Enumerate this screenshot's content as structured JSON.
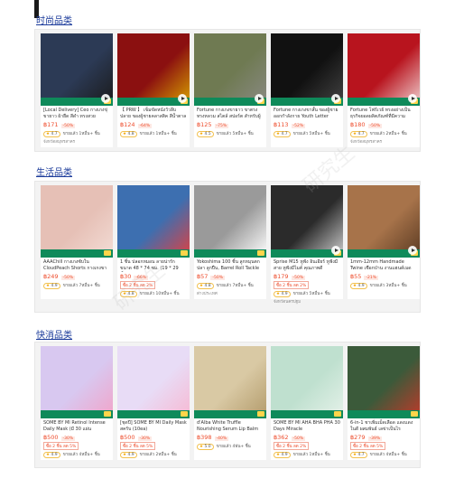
{
  "sections": [
    {
      "title": "时尚品类",
      "products": [
        {
          "title": "[Local Delivery] Ceo กางเกงขุ่ ขายาว ผ้ายืด สีดำ ทรงสวย",
          "price": "฿171",
          "discount": "-50%",
          "promo": "",
          "rating": "4.7",
          "sold": "ขายแล้ว 1หมื่น+ ชิ้น",
          "location": "จังหวัดสมุทรสาคร",
          "has_play": true,
          "colors": [
            "#2c3a55",
            "#1a1a1a"
          ]
        },
        {
          "title": "【 PRW 】 เข็มขัดหนังวัวลีบปลาย ของผู้ชายคลาสสิค สีน้ำตาล",
          "price": "฿124",
          "discount": "-64%",
          "promo": "",
          "rating": "4.8",
          "sold": "ขายแล้ว 1หมื่น+ ชิ้น",
          "location": "",
          "has_play": true,
          "colors": [
            "#8b1010",
            "#d9a400"
          ]
        },
        {
          "title": "Fortune กางเกงขายาว ขาตรง ทรงหลวม สไตล์ สปอร์ต สำหรับผู้",
          "price": "฿125",
          "discount": "-75%",
          "promo": "",
          "rating": "4.5",
          "sold": "ขายแล้ว 5หมื่น+ ชิ้น",
          "location": "",
          "has_play": true,
          "colors": [
            "#6f7a52",
            "#8a8a84"
          ]
        },
        {
          "title": "Fortune กางเกงขาสั้น ของผู้ชายออกกำลังกาย Youth Letter",
          "price": "฿113",
          "discount": "-52%",
          "promo": "",
          "rating": "4.7",
          "sold": "ขายแล้ว 5หมื่น+ ชิ้น",
          "location": "",
          "has_play": true,
          "colors": [
            "#111111",
            "#444444"
          ]
        },
        {
          "title": "Fortune โฟร์เวย์ ทรงอย่างเป็น ธุรกิจยอดผลิตภัณฑ์ที่มีความทนทาน",
          "price": "฿180",
          "discount": "-50%",
          "promo": "",
          "rating": "4.7",
          "sold": "ขายแล้ว 2หมื่น+ ชิ้น",
          "location": "จังหวัดสมุทรสาคร",
          "has_play": true,
          "colors": [
            "#b8141e",
            "#f0d0d0"
          ]
        }
      ]
    },
    {
      "title": "生活品类",
      "products": [
        {
          "title": "AAAChill กางเกงซับใน CloudPeach Shorts กางเกงขา",
          "price": "฿249",
          "discount": "-50%",
          "promo": "",
          "rating": "4.9",
          "sold": "ขายแล้ว 7หมื่น+ ชิ้น",
          "location": "",
          "has_play": false,
          "colors": [
            "#e6c0b6",
            "#f3ddd6"
          ]
        },
        {
          "title": "1 ชิ้น ปลอกหมอน ลายน่ารัก ขนาด 48 * 74 ซม. (19 * 29 นิ้ว)",
          "price": "฿30",
          "discount": "-66%",
          "promo": "ซื้อ 2 ชิ้น ลด 2%",
          "rating": "4.8",
          "sold": "ขายแล้ว 10หมื่น+ ชิ้น",
          "location": "",
          "has_play": false,
          "colors": [
            "#3d6fb0",
            "#e04040"
          ]
        },
        {
          "title": "Yokoshima 100 ชิ้น ลูกหมุนตกปลา ลูกปืน, Barrel Roll Tackle",
          "price": "฿57",
          "discount": "-50%",
          "promo": "",
          "rating": "4.8",
          "sold": "ขายแล้ว 7หมื่น+ ชิ้น",
          "location": "ต่างประเทศ",
          "has_play": false,
          "colors": [
            "#9a9a9a",
            "#ffffff"
          ]
        },
        {
          "title": "Sprise M15 หูฟัง อินเอียร์ หูฟังมีสาย หูฟังมีไมค์ คุณภาพดี",
          "price": "฿179",
          "discount": "-50%",
          "promo": "ซื้อ 2 ชิ้น ลด 2%",
          "rating": "4.9",
          "sold": "ขายแล้ว 5หมื่น+ ชิ้น",
          "location": "จังหวัดนครปฐม",
          "has_play": true,
          "colors": [
            "#2b2b2b",
            "#cfcfcf"
          ]
        },
        {
          "title": "1mm-12mm Handmade Twine เชือกป่าน งานแฮนด์เมด DIY",
          "price": "฿55",
          "discount": "-21%",
          "promo": "",
          "rating": "4.9",
          "sold": "ขายแล้ว 3หมื่น+ ชิ้น",
          "location": "",
          "has_play": true,
          "colors": [
            "#a7734a",
            "#5a3a22"
          ]
        }
      ]
    },
    {
      "title": "快消品类",
      "products": [
        {
          "title": "SOME BY MI Retinol Intense Daily Mask (มี 30 แผ่น",
          "price": "฿500",
          "discount": "-30%",
          "promo": "ซื้อ 2 ชิ้น ลด 5%",
          "rating": "4.9",
          "sold": "ขายแล้ว 4หมื่น+ ชิ้น",
          "location": "",
          "has_play": false,
          "colors": [
            "#d8c8f0",
            "#f2a3c8"
          ]
        },
        {
          "title": "[ชุดปี] SOME BY MI Daily Mask สครับ (10ea)",
          "price": "฿500",
          "discount": "-30%",
          "promo": "ซื้อ 2 ชิ้น ลด 5%",
          "rating": "4.9",
          "sold": "ขายแล้ว 2หมื่น+ ชิ้น",
          "location": "",
          "has_play": false,
          "colors": [
            "#e8dcf6",
            "#f7b8d2"
          ]
        },
        {
          "title": "d'Alba White Truffle Nourishing Serum Lip Balm",
          "price": "฿398",
          "discount": "-40%",
          "promo": "",
          "rating": "5.0",
          "sold": "ขายแล้ว 4พัน+ ชิ้น",
          "location": "",
          "has_play": false,
          "colors": [
            "#d9c9a4",
            "#b29a6a"
          ]
        },
        {
          "title": "SOME BY MI AHA BHA PHA 30 Days Miracle",
          "price": "฿362",
          "discount": "-50%",
          "promo": "ซื้อ 2 ชิ้น ลด 2%",
          "rating": "4.9",
          "sold": "ขายแล้ว 1หมื่น+ ชิ้น",
          "location": "",
          "has_play": false,
          "colors": [
            "#bfe0cf",
            "#e6f2ea"
          ]
        },
        {
          "title": "6-in-1 ชาเพิ่มเม็ดเลือด แดงแดงในดี ผสมพันธ์ เลข่าเป็นไร",
          "price": "฿279",
          "discount": "-39%",
          "promo": "ซื้อ 2 ชิ้น ลด 5%",
          "rating": "4.7",
          "sold": "ขายแล้ว 4หมื่น+ ชิ้น",
          "location": "",
          "has_play": false,
          "colors": [
            "#3b5a3a",
            "#bf3a2a"
          ]
        }
      ]
    }
  ],
  "watermark": "研究生"
}
